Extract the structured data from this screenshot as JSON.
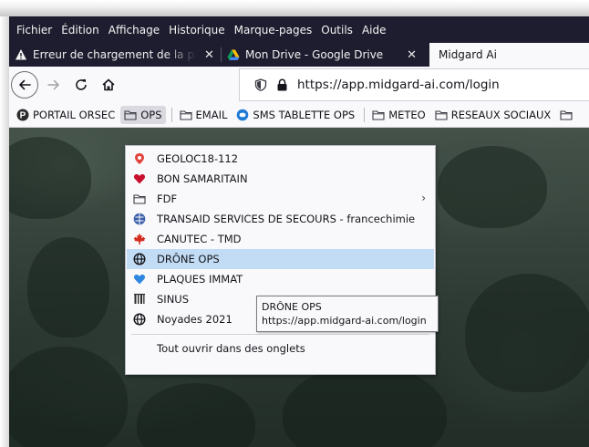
{
  "menubar": {
    "items": [
      {
        "label": "Fichier"
      },
      {
        "label": "Édition"
      },
      {
        "label": "Affichage"
      },
      {
        "label": "Historique"
      },
      {
        "label": "Marque-pages"
      },
      {
        "label": "Outils"
      },
      {
        "label": "Aide"
      }
    ]
  },
  "tabs": [
    {
      "title": "Erreur de chargement de la page",
      "icon": "warning-icon",
      "close": "✕"
    },
    {
      "title": "Mon Drive - Google Drive",
      "icon": "google-drive-icon",
      "close": "✕"
    },
    {
      "title": "Midgard Ai",
      "icon": "",
      "active": true
    }
  ],
  "navbar": {
    "back": "←",
    "forward": "→",
    "reload": "↻",
    "home": "⌂",
    "url": "https://app.midgard-ai.com/login"
  },
  "bookmarks": [
    {
      "label": "PORTAIL ORSEC",
      "icon": "portail-p-icon"
    },
    {
      "label": "OPS",
      "icon": "folder-icon",
      "open": true
    },
    {
      "label": "EMAIL",
      "icon": "folder-icon"
    },
    {
      "label": "SMS TABLETTE OPS",
      "icon": "sms-icon"
    },
    {
      "label": "METEO",
      "icon": "folder-icon"
    },
    {
      "label": "RESEAUX SOCIAUX",
      "icon": "folder-icon"
    }
  ],
  "dropdown": {
    "items": [
      {
        "label": "GEOLOC18-112",
        "icon": "geoloc-icon"
      },
      {
        "label": "BON SAMARITAIN",
        "icon": "heart-red-icon"
      },
      {
        "label": "FDF",
        "icon": "folder-icon",
        "submenu": "›"
      },
      {
        "label": "TRANSAID SERVICES DE SECOURS - francechimie",
        "icon": "transaid-icon"
      },
      {
        "label": "CANUTEC - TMD",
        "icon": "maple-leaf-icon"
      },
      {
        "label": "DRÔNE OPS",
        "icon": "globe-icon",
        "highlighted": true
      },
      {
        "label": "PLAQUES IMMAT",
        "icon": "heart-blue-icon"
      },
      {
        "label": "SINUS",
        "icon": "sinus-icon"
      },
      {
        "label": "Noyades 2021",
        "icon": "globe-icon"
      }
    ],
    "open_all": "Tout ouvrir dans des onglets"
  },
  "tooltip": {
    "title": "DRÔNE OPS",
    "url": "https://app.midgard-ai.com/login"
  },
  "colors": {
    "menubar_bg": "#1e1d2f",
    "highlight": "#c1dcf4",
    "toolbar_bg": "#f9f9fb"
  }
}
